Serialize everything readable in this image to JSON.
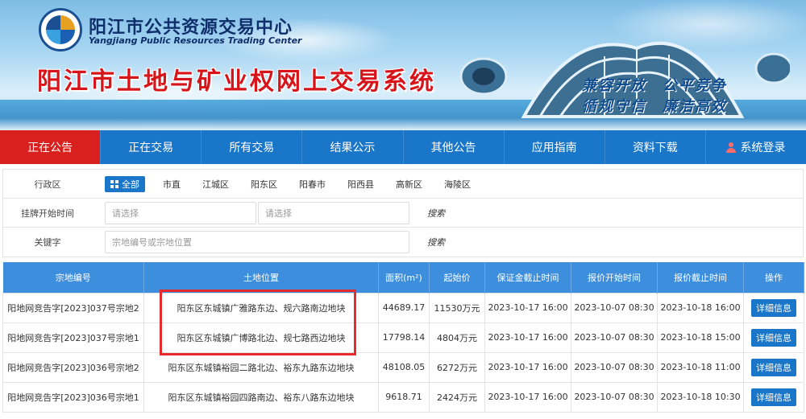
{
  "header": {
    "org_cn": "阳江市公共资源交易中心",
    "org_en": "Yangjiang Public Resources Trading Center",
    "system_title": "阳江市土地与矿业权网上交易系统",
    "slogan_line1": "兼容开放　公平竞争",
    "slogan_line2": "循规守信　廉洁高效"
  },
  "nav": {
    "items": [
      {
        "label": "正在公告"
      },
      {
        "label": "正在交易"
      },
      {
        "label": "所有交易"
      },
      {
        "label": "结果公示"
      },
      {
        "label": "其他公告"
      },
      {
        "label": "应用指南"
      },
      {
        "label": "资料下载"
      },
      {
        "label": "系统登录"
      }
    ],
    "active_index": 0
  },
  "filter": {
    "district_label": "行政区",
    "districts": [
      "全部",
      "市直",
      "江城区",
      "阳东区",
      "阳春市",
      "阳西县",
      "高新区",
      "海陵区"
    ],
    "date_label": "挂牌开始时间",
    "date_start_placeholder": "请选择",
    "date_end_placeholder": "请选择",
    "keyword_label": "关键字",
    "keyword_placeholder": "宗地编号或宗地位置",
    "search_label": "搜索"
  },
  "table": {
    "headers": [
      "宗地编号",
      "土地位置",
      "面积(m²)",
      "起始价",
      "保证金截止时间",
      "报价开始时间",
      "报价截止时间",
      "操作"
    ],
    "rows": [
      [
        "阳地网竞告字[2023]037号宗地2",
        "阳东区东城镇广雅路东边、规六路南边地块",
        "44689.17",
        "11530万元",
        "2023-10-17 16:00",
        "2023-10-07 08:30",
        "2023-10-18 16:00",
        "详细信息"
      ],
      [
        "阳地网竞告字[2023]037号宗地1",
        "阳东区东城镇广博路北边、规七路西边地块",
        "17798.14",
        "4804万元",
        "2023-10-17 16:00",
        "2023-10-07 08:30",
        "2023-10-18 15:00",
        "详细信息"
      ],
      [
        "阳地网竞告字[2023]036号宗地2",
        "阳东区东城镇裕园二路北边、裕东九路东边地块",
        "48108.05",
        "6272万元",
        "2023-10-17 16:00",
        "2023-10-07 08:30",
        "2023-10-18 11:00",
        "详细信息"
      ],
      [
        "阳地网竞告字[2023]036号宗地1",
        "阳东区东城镇裕园四路南边、裕东八路东边地块",
        "9618.71",
        "2424万元",
        "2023-10-17 16:00",
        "2023-10-07 08:30",
        "2023-10-18 10:30",
        "详细信息"
      ]
    ]
  },
  "colors": {
    "nav_blue": "#1a76c8",
    "nav_active_red": "#d8201e",
    "table_header_blue": "#3d8fde",
    "highlight_red": "#e52b2b"
  }
}
